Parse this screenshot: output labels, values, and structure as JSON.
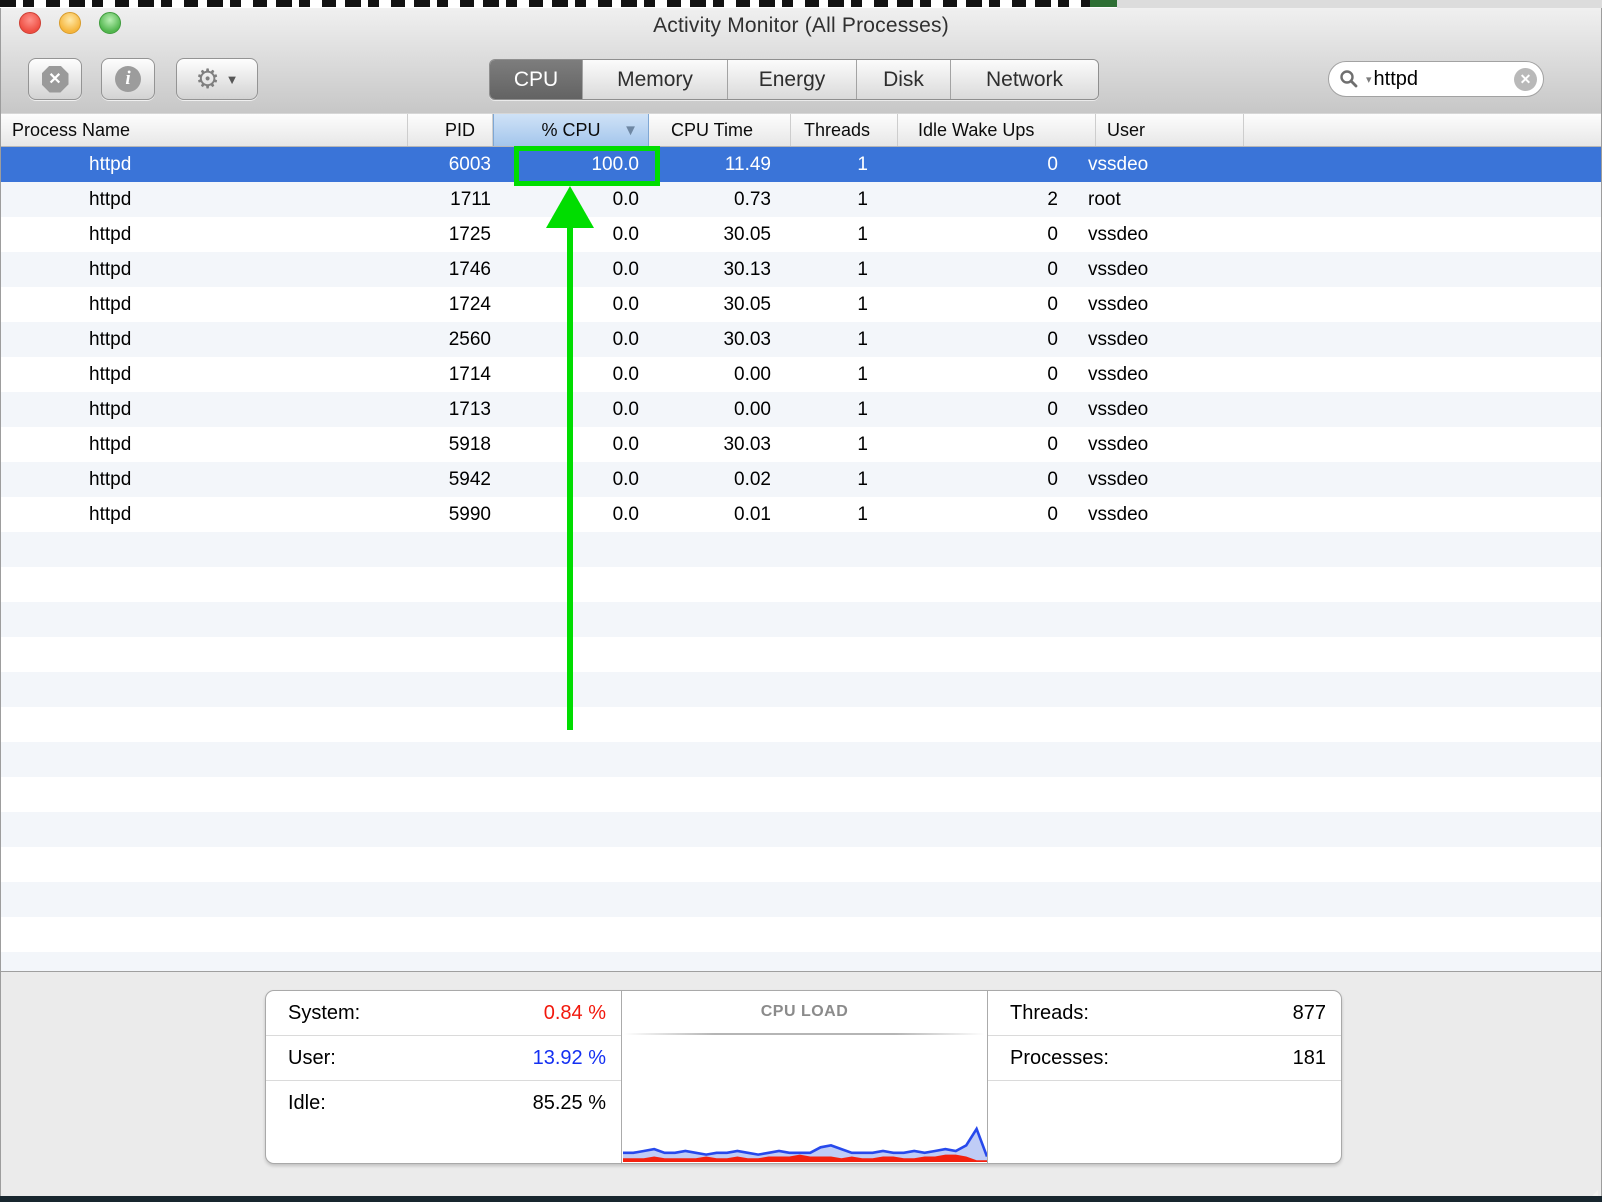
{
  "window": {
    "title": "Activity Monitor (All Processes)"
  },
  "toolbar": {
    "buttons": {
      "quit_icon": "octagon-x",
      "quit_glyph": "✕",
      "inspect_icon": "info-circle",
      "inspect_glyph": "i",
      "settings_icon": "gear",
      "settings_glyph": "⚙",
      "settings_caret": "▼"
    },
    "tabs": [
      "CPU",
      "Memory",
      "Energy",
      "Disk",
      "Network"
    ],
    "active_tab": "CPU",
    "search": {
      "value": "httpd",
      "icon": "magnifier",
      "caret": "▾",
      "clear_glyph": "✕"
    }
  },
  "table": {
    "headers": [
      "Process Name",
      "PID",
      "% CPU",
      "CPU Time",
      "Threads",
      "Idle Wake Ups",
      "User"
    ],
    "sort": {
      "column": "% CPU",
      "direction": "descending",
      "glyph": "▼"
    },
    "rows": [
      {
        "name": "httpd",
        "pid": "6003",
        "cpu": "100.0",
        "cpu_time": "11.49",
        "threads": "1",
        "idle_wake_ups": "0",
        "user": "vssdeo",
        "selected": true
      },
      {
        "name": "httpd",
        "pid": "1711",
        "cpu": "0.0",
        "cpu_time": "0.73",
        "threads": "1",
        "idle_wake_ups": "2",
        "user": "root"
      },
      {
        "name": "httpd",
        "pid": "1725",
        "cpu": "0.0",
        "cpu_time": "30.05",
        "threads": "1",
        "idle_wake_ups": "0",
        "user": "vssdeo"
      },
      {
        "name": "httpd",
        "pid": "1746",
        "cpu": "0.0",
        "cpu_time": "30.13",
        "threads": "1",
        "idle_wake_ups": "0",
        "user": "vssdeo"
      },
      {
        "name": "httpd",
        "pid": "1724",
        "cpu": "0.0",
        "cpu_time": "30.05",
        "threads": "1",
        "idle_wake_ups": "0",
        "user": "vssdeo"
      },
      {
        "name": "httpd",
        "pid": "2560",
        "cpu": "0.0",
        "cpu_time": "30.03",
        "threads": "1",
        "idle_wake_ups": "0",
        "user": "vssdeo"
      },
      {
        "name": "httpd",
        "pid": "1714",
        "cpu": "0.0",
        "cpu_time": "0.00",
        "threads": "1",
        "idle_wake_ups": "0",
        "user": "vssdeo"
      },
      {
        "name": "httpd",
        "pid": "1713",
        "cpu": "0.0",
        "cpu_time": "0.00",
        "threads": "1",
        "idle_wake_ups": "0",
        "user": "vssdeo"
      },
      {
        "name": "httpd",
        "pid": "5918",
        "cpu": "0.0",
        "cpu_time": "30.03",
        "threads": "1",
        "idle_wake_ups": "0",
        "user": "vssdeo"
      },
      {
        "name": "httpd",
        "pid": "5942",
        "cpu": "0.0",
        "cpu_time": "0.02",
        "threads": "1",
        "idle_wake_ups": "0",
        "user": "vssdeo"
      },
      {
        "name": "httpd",
        "pid": "5990",
        "cpu": "0.0",
        "cpu_time": "0.01",
        "threads": "1",
        "idle_wake_ups": "0",
        "user": "vssdeo"
      }
    ],
    "selection_color": "#3a74d8",
    "stripe_color": "#f3f6fa"
  },
  "annotation": {
    "shape": "box-and-up-arrow",
    "target_value": "100.0",
    "color": "#00dd00"
  },
  "footer": {
    "cpu_stats": [
      {
        "label": "System:",
        "value": "0.84 %",
        "color": "#f2180c"
      },
      {
        "label": "User:",
        "value": "13.92 %",
        "color": "#1430f2"
      },
      {
        "label": "Idle:",
        "value": "85.25 %",
        "color": "#000000"
      }
    ],
    "right_stats": [
      {
        "label": "Threads:",
        "value": "877"
      },
      {
        "label": "Processes:",
        "value": "181"
      }
    ]
  },
  "chart_data": {
    "type": "area",
    "title": "CPU LOAD",
    "legend_position": "none",
    "grid": false,
    "ymax": 25,
    "series": [
      {
        "name": "user-load",
        "color": "#2749ec",
        "fill": "rgba(148,170,240,0.6)",
        "values": [
          5,
          5,
          6,
          7,
          5,
          5,
          6,
          5,
          4,
          5,
          5,
          6,
          5,
          4,
          5,
          6,
          5,
          5,
          5,
          8,
          9,
          7,
          5,
          5,
          5,
          6,
          5,
          5,
          6,
          5,
          6,
          7,
          6,
          9,
          18,
          3
        ]
      },
      {
        "name": "system-load",
        "color": "#f3210f",
        "fill": "#f3210f",
        "values": [
          2,
          2,
          2,
          3,
          2,
          2,
          2,
          2,
          3,
          2,
          2,
          3,
          2,
          2,
          3,
          3,
          3,
          4,
          3,
          3,
          3,
          2,
          3,
          2,
          2,
          3,
          3,
          2,
          2,
          3,
          3,
          4,
          4,
          3,
          1,
          1
        ]
      }
    ]
  }
}
